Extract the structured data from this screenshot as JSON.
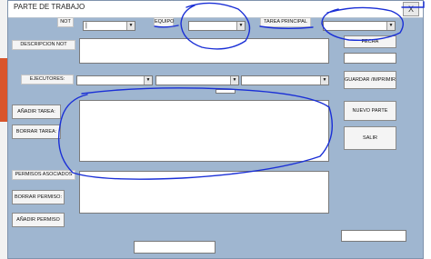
{
  "window": {
    "title": "PARTE DE TRABAJO",
    "close_label": "X"
  },
  "header": {
    "not_label": "NOT",
    "not_value": "|",
    "equipo_label": "EQUIPO",
    "equipo_value": "",
    "tarea_label": "TAREA PRINCIPAL",
    "tarea_value": ""
  },
  "descripcion": {
    "label": "DESCRIPCION NOT",
    "value": ""
  },
  "ejecutores": {
    "label": "EJECUTORES:",
    "values": [
      "",
      "",
      ""
    ]
  },
  "tareas": {
    "add_label": "AÑADIR TAREA:",
    "delete_label": "BORRAR TAREA:",
    "value": ""
  },
  "permisos": {
    "label": "PERMISOS ASOCIADOS",
    "delete_label": "BORRAR PERMISO:",
    "add_label": "AÑADIR PERMISO",
    "value": ""
  },
  "side": {
    "fecha_label": "FECHA",
    "fecha_value": "",
    "guardar_label": "GUARDAR /IMPRIMIR",
    "nuevo_label": "NUEVO PARTE",
    "salir_label": "SALIR"
  },
  "footer": {
    "center_value": "",
    "right_value": ""
  },
  "colors": {
    "form_bg": "#9fb6d0",
    "annotation": "#1a2fd6",
    "side_accent": "#d9552b"
  }
}
